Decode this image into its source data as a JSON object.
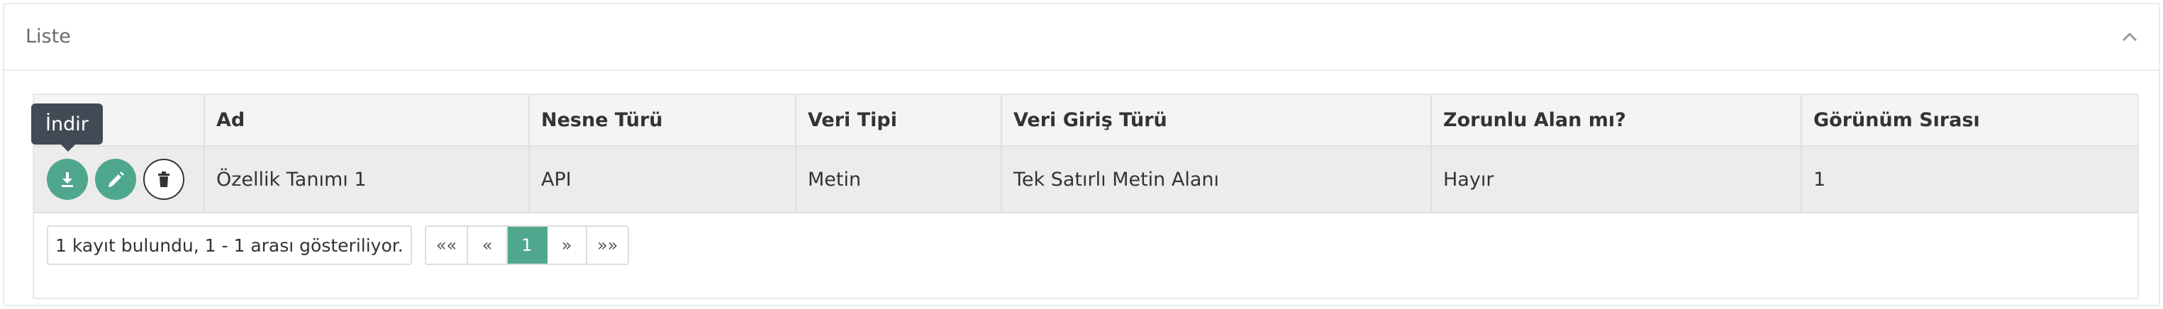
{
  "panel": {
    "title": "Liste"
  },
  "tooltip": {
    "text": "İndir"
  },
  "table": {
    "headers": [
      "",
      "Ad",
      "Nesne Türü",
      "Veri Tipi",
      "Veri Giriş Türü",
      "Zorunlu Alan mı?",
      "Görünüm Sırası"
    ],
    "rows": [
      {
        "ad": "Özellik Tanımı 1",
        "nesne_turu": "API",
        "veri_tipi": "Metin",
        "veri_giris_turu": "Tek Satırlı Metin Alanı",
        "zorunlu": "Hayır",
        "gorunum_sirasi": "1"
      }
    ]
  },
  "pagination": {
    "info": "1 kayıt bulundu, 1 - 1 arası gösteriliyor.",
    "first": "««",
    "prev": "«",
    "current": "1",
    "next": "»",
    "last": "»»"
  },
  "colors": {
    "accent": "#4fa88e",
    "tooltip_bg": "#414a55"
  },
  "icons": {
    "download": "download-icon",
    "edit": "pencil-icon",
    "delete": "trash-icon",
    "collapse": "chevron-up-icon"
  }
}
